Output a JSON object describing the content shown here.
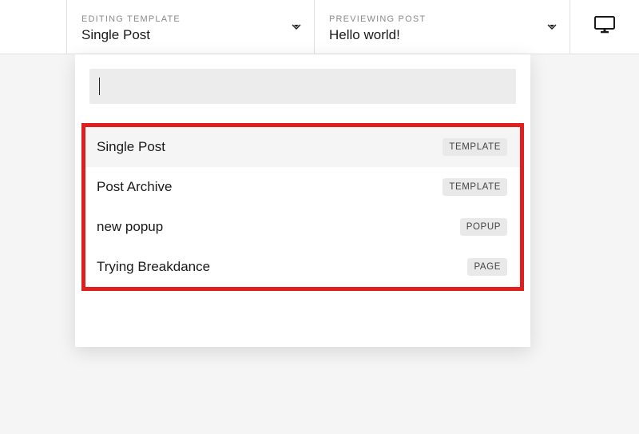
{
  "topbar": {
    "editing_label": "EDITING TEMPLATE",
    "editing_value": "Single Post",
    "preview_label": "PREVIEWING POST",
    "preview_value": "Hello world!"
  },
  "search": {
    "value": "",
    "placeholder": ""
  },
  "items": [
    {
      "label": "Single Post",
      "badge": "TEMPLATE"
    },
    {
      "label": "Post Archive",
      "badge": "TEMPLATE"
    },
    {
      "label": "new popup",
      "badge": "POPUP"
    },
    {
      "label": "Trying Breakdance",
      "badge": "PAGE"
    }
  ],
  "icons": {
    "chevron": "chevron-down",
    "device": "desktop"
  }
}
